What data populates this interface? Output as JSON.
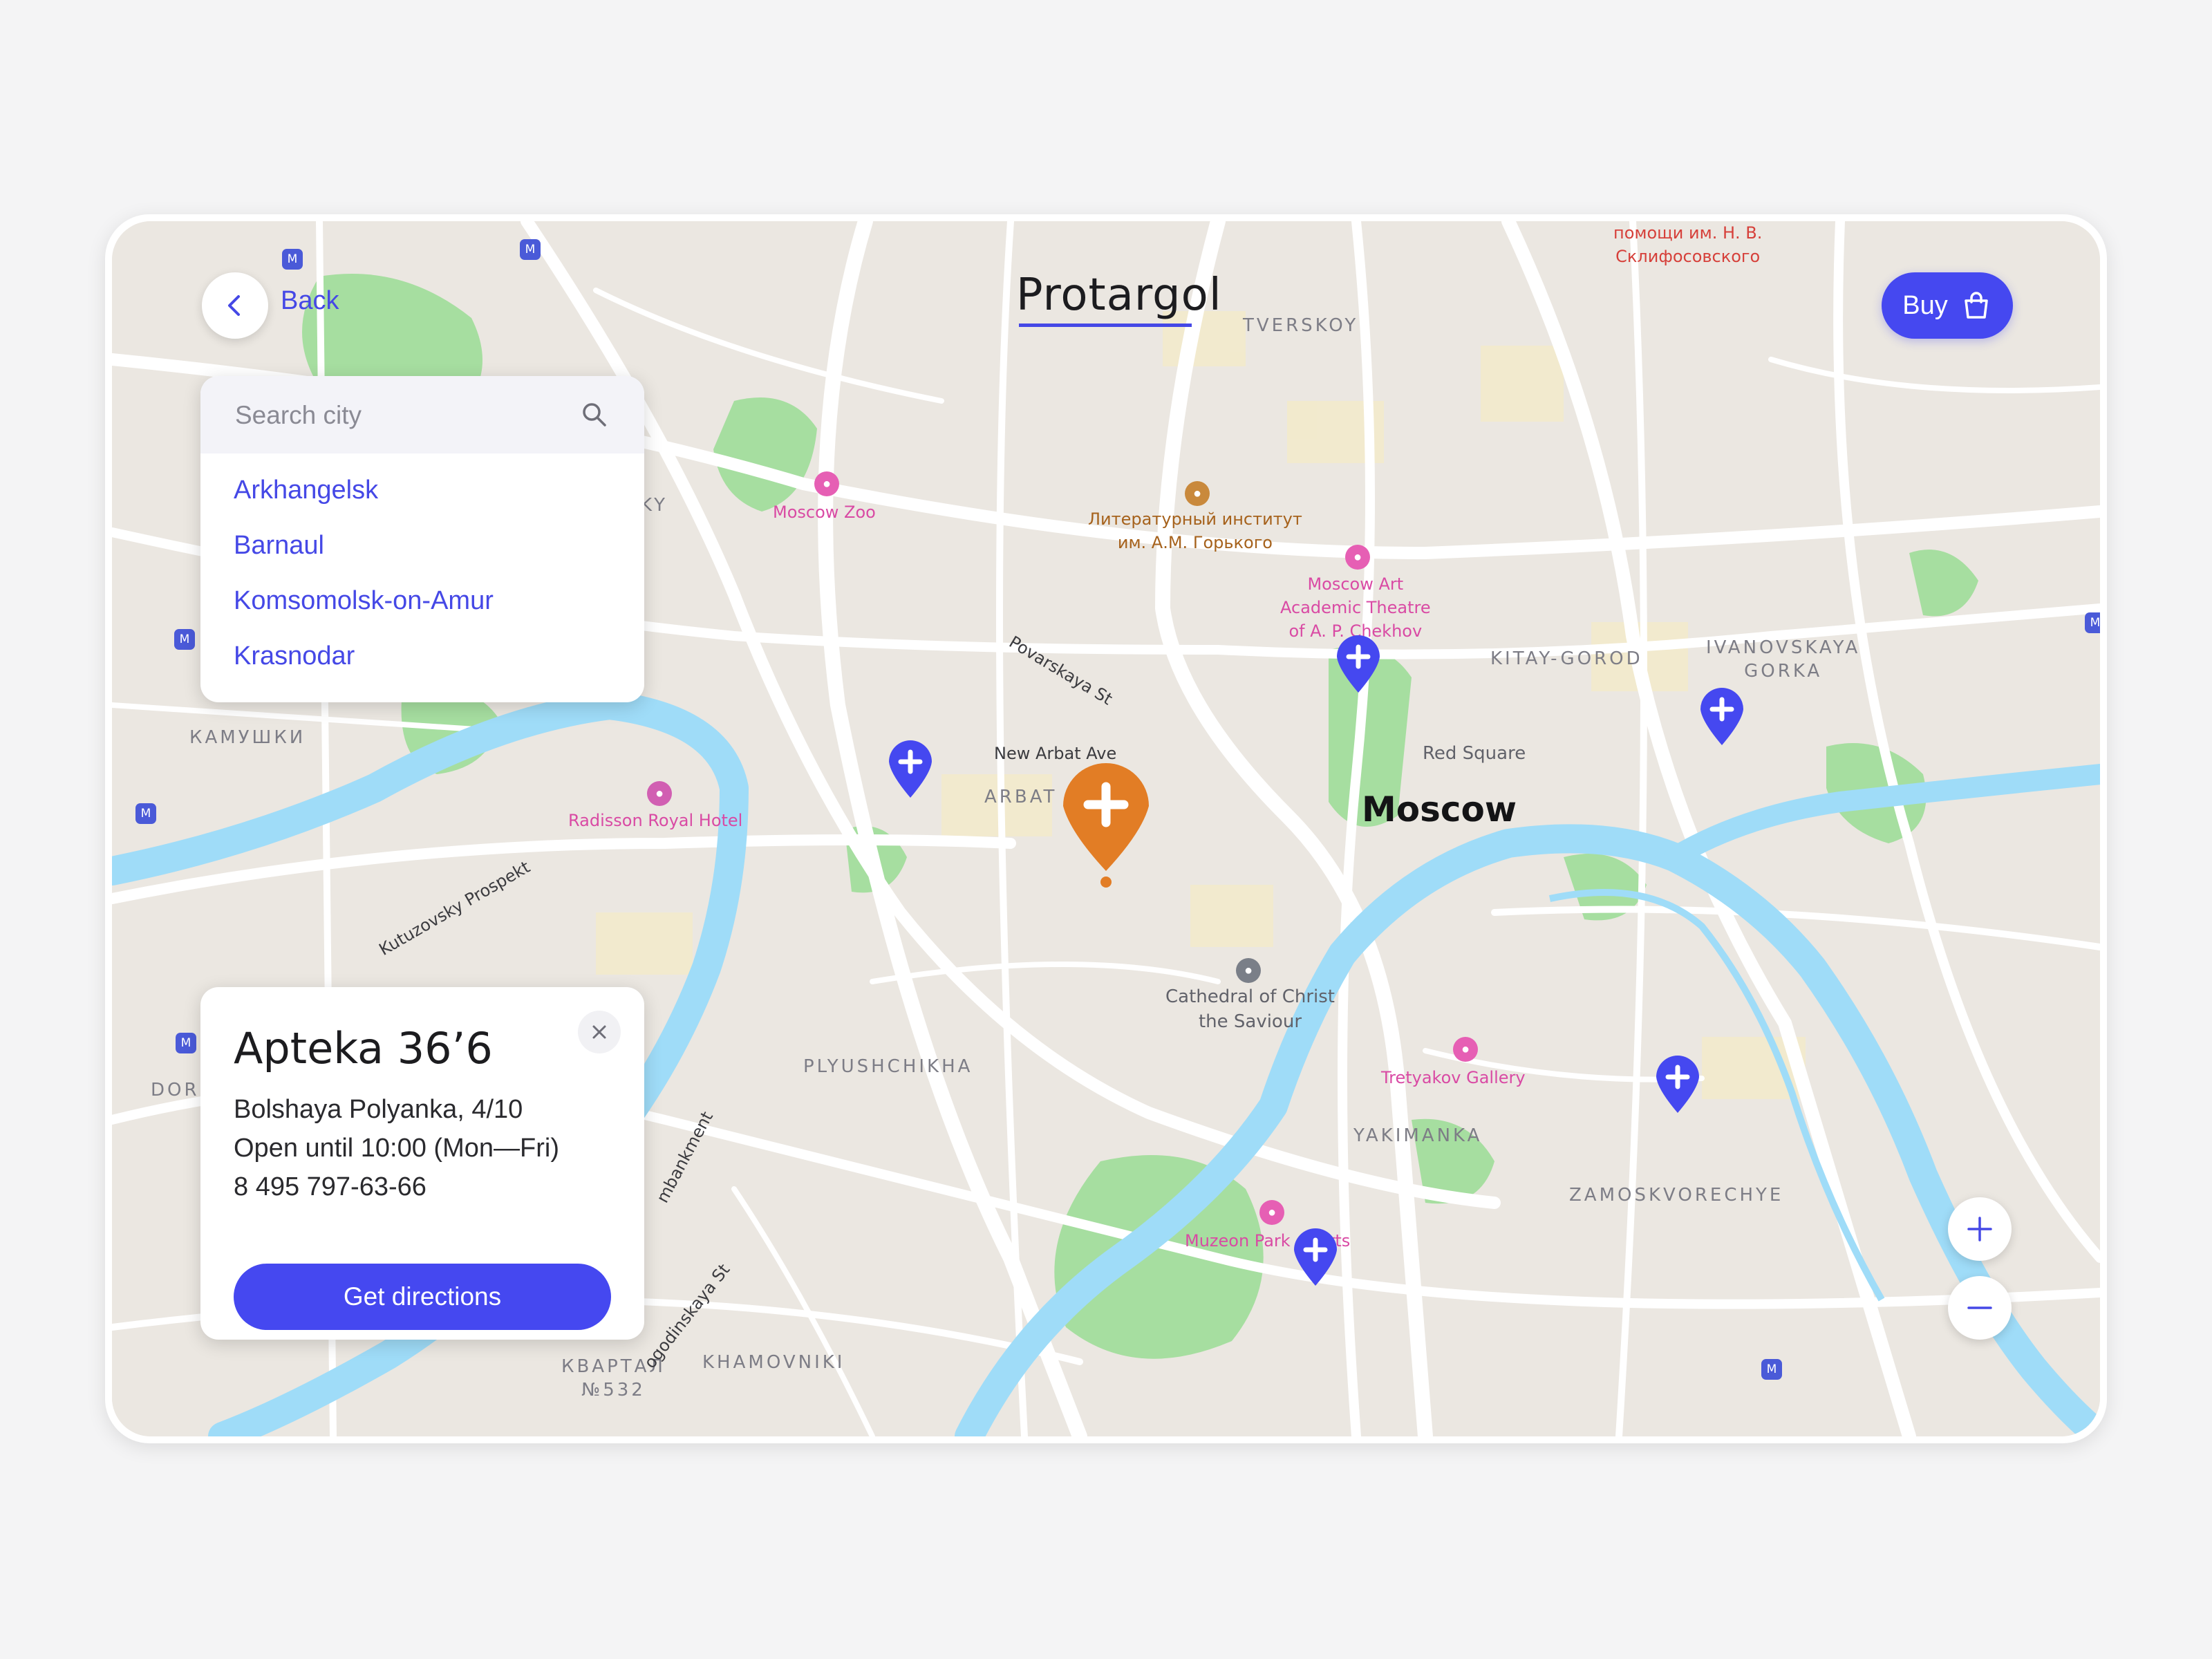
{
  "header": {
    "back_label": "Back",
    "app_title": "Protargol",
    "buy_label": "Buy"
  },
  "search": {
    "placeholder": "Search city",
    "cities": [
      "Arkhangelsk",
      "Barnaul",
      "Komsomolsk-on-Amur",
      "Krasnodar"
    ]
  },
  "info_card": {
    "name": "Apteka 36’6",
    "address": "Bolshaya Polyanka, 4/10",
    "hours": "Open until 10:00 (Mon—Fri)",
    "phone": "8 495 797-63-66",
    "directions_label": "Get directions"
  },
  "map": {
    "city_label": "Moscow",
    "districts": {
      "tverskoy": "TVERSKOY",
      "kitay_gorod": "KITAY-GOROD",
      "ivanovskaya_1": "IVANOVSKAYA",
      "ivanovskaya_2": "GORKA",
      "arbat": "ARBAT",
      "plyushchikha": "PLYUSHCHIKHA",
      "yakimanka": "YAKIMANKA",
      "zamoskvorechye": "ZAMOSKVORECHYE",
      "khamovniki": "KHAMOVNIKI",
      "kamushki": "КАМУШКИ",
      "kvartal_1": "КВАРТАЛ",
      "kvartal_2": "№532",
      "dor": "DOR",
      "ky": "KY"
    },
    "pois": {
      "moscow_zoo": "Moscow Zoo",
      "lit_institute_1": "Литературный институт",
      "lit_institute_2": "им. А.М. Горького",
      "art_theatre_1": "Moscow Art",
      "art_theatre_2": "Academic Theatre",
      "art_theatre_3": "of A. P. Chekhov",
      "hospital_1": "помощи им. Н. В.",
      "hospital_2": "Склифосовского",
      "red_square": "Red Square",
      "radisson": "Radisson Royal Hotel",
      "cathedral_1": "Cathedral of Christ",
      "cathedral_2": "the Saviour",
      "tretyakov": "Tretyakov Gallery",
      "muzeon": "Muzeon Park of Arts"
    },
    "streets": {
      "povarskaya": "Povarskaya St",
      "new_arbat": "New Arbat Ave",
      "kutuzovsky": "Kutuzovsky Prospekt",
      "embankment": "mbankment",
      "pogodinskaya": "ogodinskaya St"
    }
  },
  "colors": {
    "accent": "#4548f0",
    "selected_pin": "#e27d25",
    "water": "#9fdcf8",
    "park": "#a6dea0",
    "land": "#ebe7e1"
  },
  "icons": {
    "back": "chevron-left-icon",
    "buy": "shopping-bag-icon",
    "search": "search-icon",
    "close": "close-icon",
    "pharmacy": "pharmacy-cross-icon",
    "zoom_in": "plus-icon",
    "zoom_out": "minus-icon"
  }
}
